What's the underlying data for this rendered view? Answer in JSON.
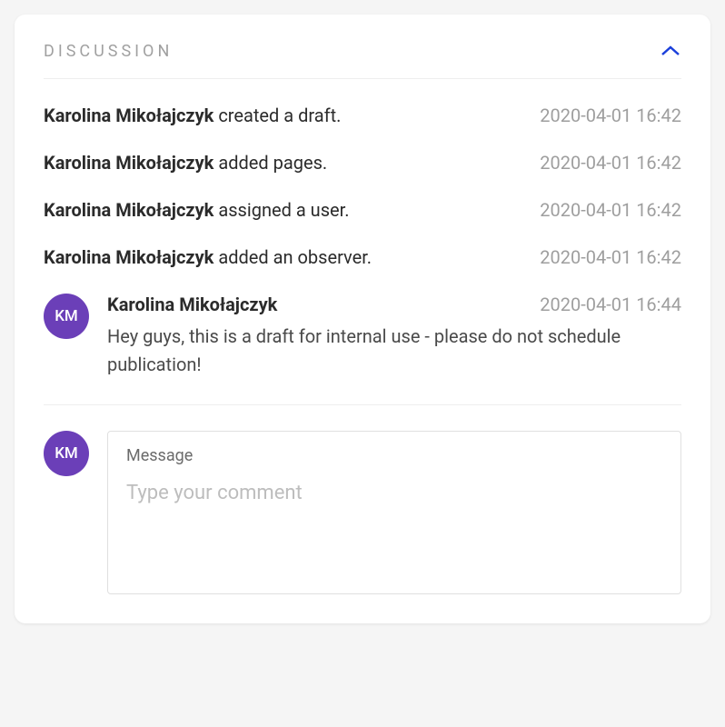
{
  "header": {
    "title": "DISCUSSION"
  },
  "activities": [
    {
      "actor": "Karolina Mikołajczyk",
      "action": " created a draft.",
      "time": "2020-04-01 16:42"
    },
    {
      "actor": "Karolina Mikołajczyk",
      "action": " added pages.",
      "time": "2020-04-01 16:42"
    },
    {
      "actor": "Karolina Mikołajczyk",
      "action": " assigned a user.",
      "time": "2020-04-01 16:42"
    },
    {
      "actor": "Karolina Mikołajczyk",
      "action": " added an observer.",
      "time": "2020-04-01 16:42"
    }
  ],
  "comments": [
    {
      "initials": "KM",
      "author": "Karolina Mikołajczyk",
      "time": "2020-04-01 16:44",
      "text": "Hey guys, this is a draft for internal use - please do not schedule publication!"
    }
  ],
  "compose": {
    "avatar_initials": "KM",
    "label": "Message",
    "placeholder": "Type your comment"
  }
}
